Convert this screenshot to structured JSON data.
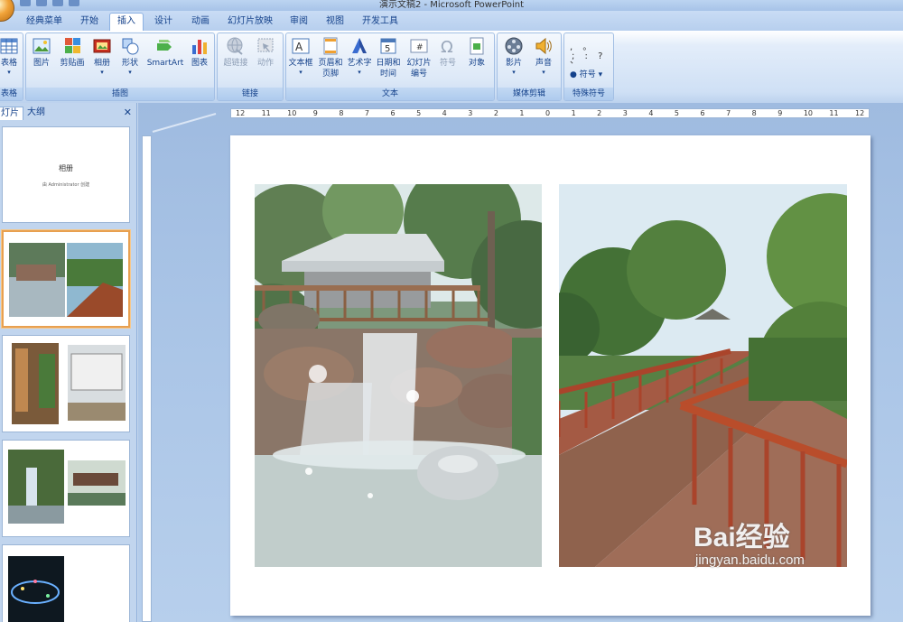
{
  "window": {
    "title": "演示文稿2 - Microsoft PowerPoint"
  },
  "tabs": [
    "经典菜单",
    "开始",
    "插入",
    "设计",
    "动画",
    "幻灯片放映",
    "审阅",
    "视图",
    "开发工具"
  ],
  "active_tab": "插入",
  "ribbon": {
    "groups": {
      "tables": "表格",
      "illustrations": "插图",
      "links": "链接",
      "text": "文本",
      "media": "媒体剪辑",
      "special": "特殊符号"
    },
    "buttons": {
      "table": "表格",
      "picture": "图片",
      "clipart": "剪贴画",
      "album": "相册",
      "shapes": "形状",
      "smartart": "SmartArt",
      "chart": "图表",
      "hyperlink": "超链接",
      "action": "动作",
      "textbox": "文本框",
      "header_footer_1": "页眉和",
      "header_footer_2": "页脚",
      "wordart": "艺术字",
      "datetime_1": "日期和",
      "datetime_2": "时间",
      "slidenum_1": "幻灯片",
      "slidenum_2": "编号",
      "symbol": "符号",
      "object": "对象",
      "movie": "影片",
      "sound": "声音",
      "special_symbol": "符号",
      "punct_row1": ", 。 、",
      "punct_row2": "; : ?"
    }
  },
  "left_pane": {
    "tab_slides": "灯片",
    "tab_outline": "大纲",
    "close": "✕",
    "slide1_title": "相册",
    "slide1_subtitle": "由 Administrator 创建"
  },
  "ruler": {
    "h_labels": [
      "12",
      "11",
      "10",
      "9",
      "8",
      "7",
      "6",
      "5",
      "4",
      "3",
      "2",
      "1",
      "0",
      "1",
      "2",
      "3",
      "4",
      "5",
      "6",
      "7",
      "8",
      "9",
      "10",
      "11",
      "12"
    ]
  },
  "watermark": {
    "line1": "Bai经验",
    "line2": "jingyan.baidu.com"
  }
}
